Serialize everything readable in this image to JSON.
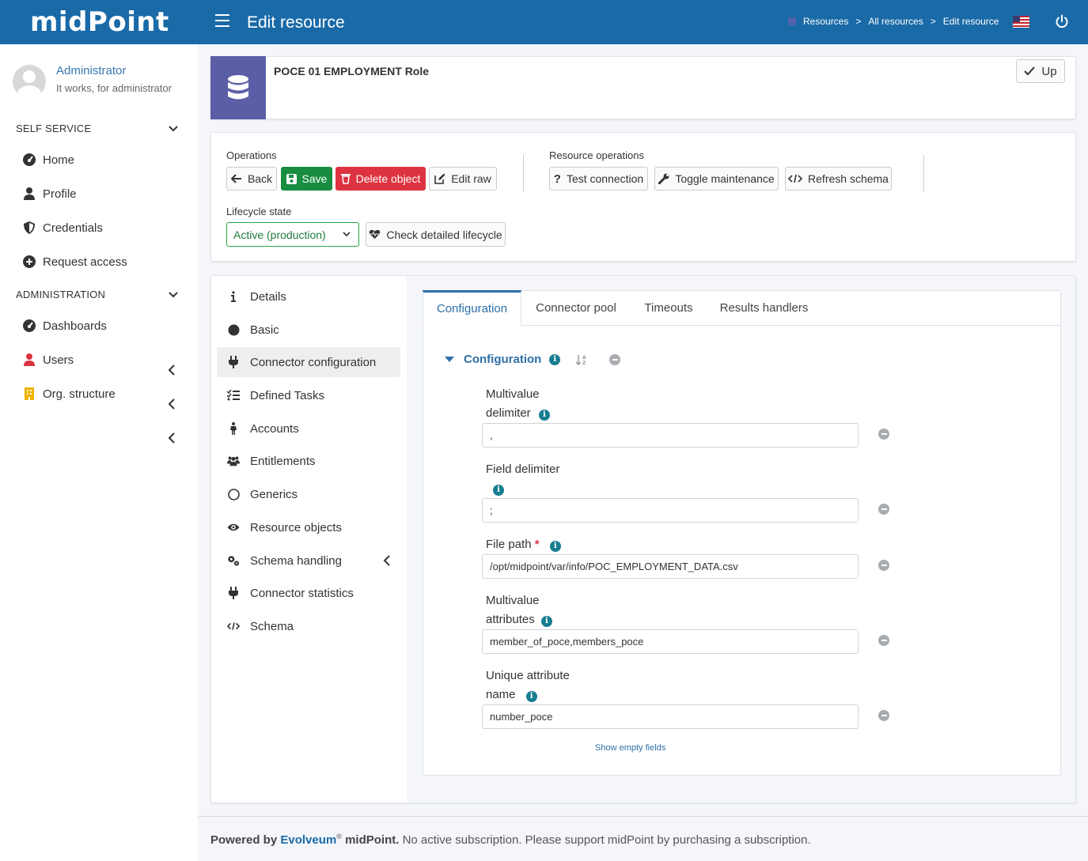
{
  "header": {
    "logo": "midPoint",
    "page_title": "Edit resource",
    "breadcrumb": [
      "Resources",
      "All resources",
      "Edit resource"
    ],
    "breadcrumb_sep": ">"
  },
  "user": {
    "name": "Administrator",
    "subtitle": "It works, for administrator"
  },
  "sidebar": {
    "self_service_title": "SELF SERVICE",
    "self_service_items": [
      "Home",
      "Profile",
      "Credentials",
      "Request access"
    ],
    "admin_title": "ADMINISTRATION",
    "admin_items": [
      "Dashboards",
      "Users",
      "Org. structure"
    ]
  },
  "object": {
    "title": "POCE 01 EMPLOYMENT Role",
    "up_label": "Up"
  },
  "operations": {
    "title": "Operations",
    "back": "Back",
    "save": "Save",
    "delete": "Delete object",
    "edit_raw": "Edit raw",
    "resource_ops_title": "Resource operations",
    "test_connection": "Test connection",
    "toggle_maintenance": "Toggle maintenance",
    "refresh_schema": "Refresh schema",
    "lifecycle_label": "Lifecycle state",
    "lifecycle_value": "Active (production)",
    "check_lifecycle": "Check detailed lifecycle"
  },
  "menu": {
    "items": [
      "Details",
      "Basic",
      "Connector configuration",
      "Defined Tasks",
      "Accounts",
      "Entitlements",
      "Generics",
      "Resource objects",
      "Schema handling",
      "Connector statistics",
      "Schema"
    ],
    "active": "Connector configuration"
  },
  "tabs": {
    "items": [
      "Configuration",
      "Connector pool",
      "Timeouts",
      "Results handlers"
    ],
    "active": "Configuration"
  },
  "configuration": {
    "heading": "Configuration",
    "fields": [
      {
        "label_line1": "Multivalue",
        "label_line2": "delimiter",
        "value": ","
      },
      {
        "label_line1": "Field delimiter",
        "label_line2": "",
        "value": ";"
      },
      {
        "label_line1": "File path",
        "label_line2": "",
        "value": "/opt/midpoint/var/info/POC_EMPLOYMENT_DATA.csv",
        "required": "*"
      },
      {
        "label_line1": "Multivalue",
        "label_line2": "attributes",
        "value": "member_of_poce,members_poce"
      },
      {
        "label_line1": "Unique attribute",
        "label_line2": "name",
        "value": "number_poce"
      }
    ],
    "show_empty": "Show empty fields"
  },
  "footer": {
    "powered_by": "Powered by",
    "brand": "Evolveum",
    "reg": "®",
    "product": "midPoint.",
    "notice": "No active subscription. Please support midPoint by purchasing a subscription."
  },
  "colors": {
    "header_bg": "#1a6aa8",
    "accent": "#2d6fa8",
    "save": "#188d42",
    "delete": "#dd3340",
    "object_icon": "#5b5ea6",
    "lifecycle": "#28a745"
  }
}
